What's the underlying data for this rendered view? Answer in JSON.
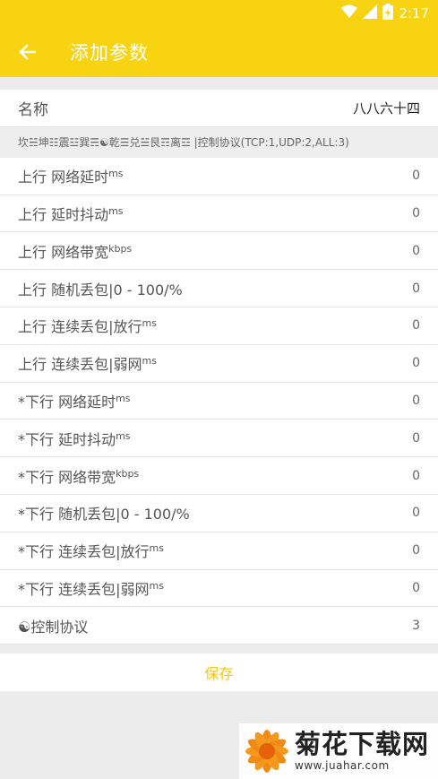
{
  "status": {
    "time": "2:17"
  },
  "appbar": {
    "title": "添加参数"
  },
  "name_row": {
    "label": "名称",
    "value": "八八六十四"
  },
  "hint": "坎☵坤☷震☳巽☴☯乾☰兑☱艮☶离☲ |控制协议(TCP:1,UDP:2,ALL:3)",
  "params": [
    {
      "label": "上行 网络延时",
      "unit": "ms",
      "value": "0"
    },
    {
      "label": "上行 延时抖动",
      "unit": "ms",
      "value": "0"
    },
    {
      "label": "上行 网络带宽",
      "unit": "kbps",
      "value": "0"
    },
    {
      "label": "上行 随机丢包|0 - 100/%",
      "unit": "",
      "value": "0"
    },
    {
      "label": "上行 连续丢包|放行",
      "unit": "ms",
      "value": "0"
    },
    {
      "label": "上行 连续丢包|弱网",
      "unit": "ms",
      "value": "0"
    },
    {
      "label": "*下行 网络延时",
      "unit": "ms",
      "value": "0"
    },
    {
      "label": "*下行 延时抖动",
      "unit": "ms",
      "value": "0"
    },
    {
      "label": "*下行 网络带宽",
      "unit": "kbps",
      "value": "0"
    },
    {
      "label": "*下行 随机丢包|0 - 100/%",
      "unit": "",
      "value": "0"
    },
    {
      "label": "*下行 连续丢包|放行",
      "unit": "ms",
      "value": "0"
    },
    {
      "label": "*下行 连续丢包|弱网",
      "unit": "ms",
      "value": "0"
    },
    {
      "label": "☯控制协议",
      "unit": "",
      "value": "3"
    }
  ],
  "save_label": "保存",
  "watermark": {
    "brand": "菊花下载网",
    "url": "www.juahar.com"
  },
  "colors": {
    "accent": "#f7d311",
    "save": "#f2c611"
  }
}
